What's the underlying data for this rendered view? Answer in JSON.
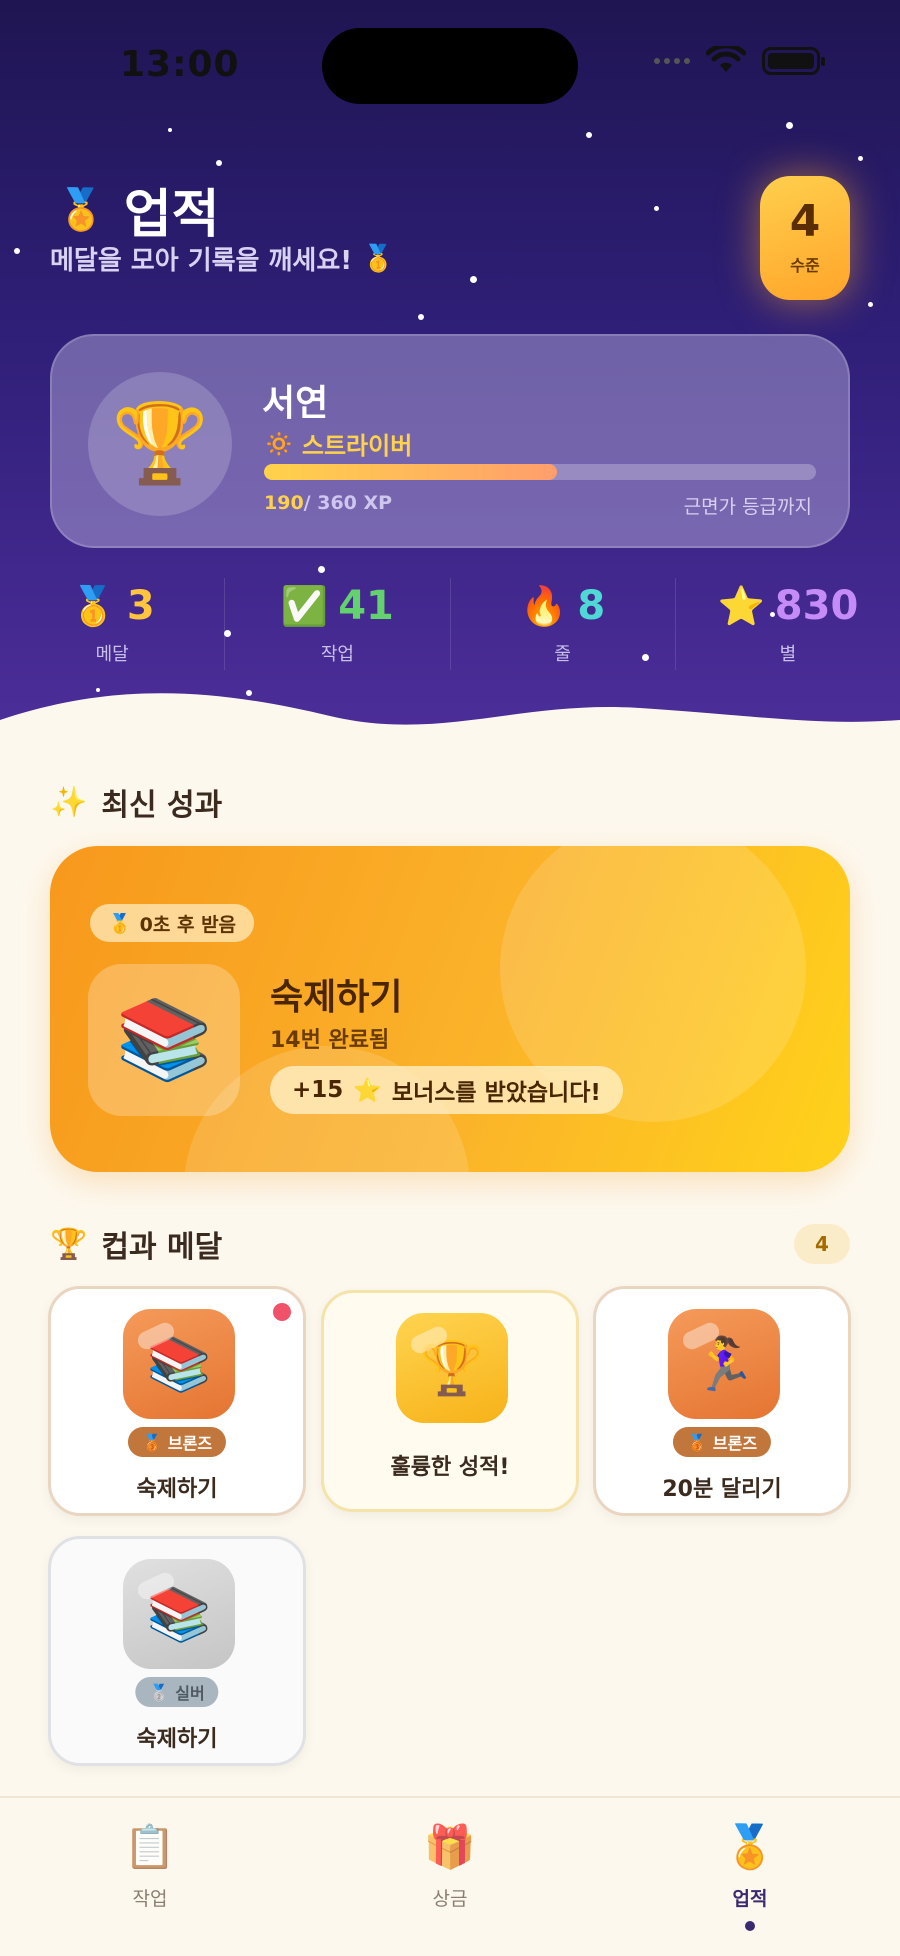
{
  "status": {
    "time": "13:00"
  },
  "header": {
    "icon": "🏅",
    "title": "업적",
    "subtitle": "메달을 모아 기록을 깨세요!",
    "subtitle_icon": "🥇"
  },
  "level": {
    "value": "4",
    "label": "수준"
  },
  "profile": {
    "name": "서연",
    "rank_icon": "🔅",
    "rank": "스트라이버",
    "xp_current": "190",
    "xp_total": "/ 360 XP",
    "xp_progress": 0.53,
    "next_rank": "근면가 등급까지"
  },
  "stats": [
    {
      "icon": "🥇",
      "value": "3",
      "label": "메달",
      "color": "#ffc53d"
    },
    {
      "icon": "✅",
      "value": "41",
      "label": "작업",
      "color": "#63d16e"
    },
    {
      "icon": "🔥",
      "value": "8",
      "label": "줄",
      "color": "#4fd8d6"
    },
    {
      "icon": "⭐",
      "value": "830",
      "label": "별",
      "color": "#c58cf7"
    }
  ],
  "recent": {
    "section_icon": "✨",
    "section_title": "최신 성과",
    "pill_icon": "🥇",
    "pill_text": "0초 후 받음",
    "icon": "📚",
    "title": "숙제하기",
    "subtitle": "14번 완료됨",
    "bonus_amount": "+15",
    "bonus_icon": "⭐",
    "bonus_text": "보너스를 받았습니다!"
  },
  "medals": {
    "section_icon": "🏆",
    "section_title": "컵과 메달",
    "count": "4",
    "items": [
      {
        "icon": "📚",
        "tier_icon": "🥉",
        "tier": "브론즈",
        "name": "숙제하기"
      },
      {
        "icon": "🏆",
        "name": "훌륭한 성적!"
      },
      {
        "icon": "🏃‍♀️",
        "tier_icon": "🥉",
        "tier": "브론즈",
        "name": "20분 달리기"
      },
      {
        "icon": "📚",
        "tier_icon": "🥈",
        "tier": "실버",
        "name": "숙제하기"
      }
    ]
  },
  "tabbar": [
    {
      "icon": "📋",
      "label": "작업"
    },
    {
      "icon": "🎁",
      "label": "상금"
    },
    {
      "icon": "🏅",
      "label": "업적"
    }
  ]
}
